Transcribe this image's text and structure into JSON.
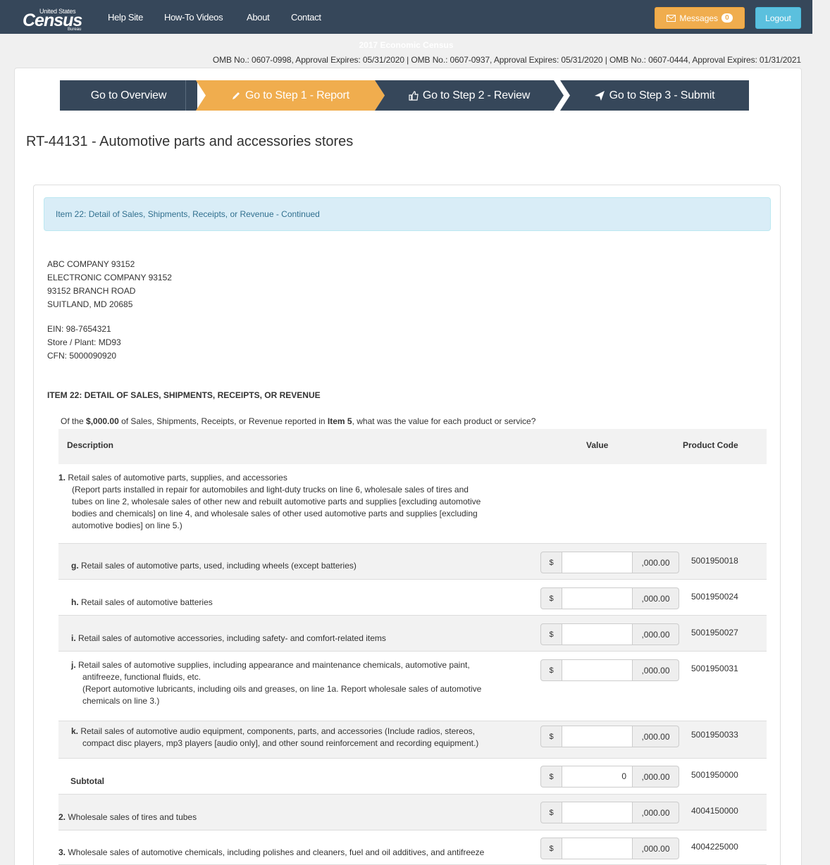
{
  "nav": {
    "logo_top": "United States",
    "logo_main": "Census",
    "logo_bottom": "Bureau",
    "links": [
      "Help Site",
      "How-To Videos",
      "About",
      "Contact"
    ],
    "messages_label": "Messages",
    "messages_count": "0",
    "logout_label": "Logout"
  },
  "header": {
    "title": "2017 Economic Census",
    "omb": "OMB No.: 0607-0998, Approval Expires: 05/31/2020  |  OMB No.: 0607-0937, Approval Expires: 05/31/2020  |  OMB No.: 0607-0444, Approval Expires: 01/31/2021"
  },
  "steps": [
    "Go to Overview",
    "Go to Step 1 - Report",
    "Go to Step 2 - Review",
    "Go to Step 3 - Submit"
  ],
  "page_title": "RT-44131 - Automotive parts and accessories stores",
  "alert": "Item 22: Detail of Sales, Shipments, Receipts, or Revenue - Continued",
  "company": {
    "lines": [
      "ABC COMPANY 93152",
      "ELECTRONIC COMPANY 93152",
      "93152 BRANCH ROAD",
      "SUITLAND, MD 20685"
    ],
    "ein": "EIN: 98-7654321",
    "store": "Store / Plant: MD93",
    "cfn": "CFN: 5000090920"
  },
  "item": {
    "heading": "ITEM 22: DETAIL OF SALES, SHIPMENTS, RECEIPTS, OR REVENUE",
    "q_pre": "Of the ",
    "q_amount": "$,000.00",
    "q_mid": " of Sales, Shipments, Receipts, or Revenue reported in ",
    "q_item": "Item 5",
    "q_post": ", what was the value for each product or service?"
  },
  "table": {
    "col_description": "Description",
    "col_value": "Value",
    "col_code": "Product Code",
    "currency": "$",
    "suffix": ",000.00"
  },
  "line1": {
    "num": "1.",
    "title": "Retail sales of automotive parts, supplies, and accessories",
    "note": [
      "(Report parts installed in repair for automobiles and light-duty trucks on line 6, wholesale sales of tires and",
      "tubes on line 2, wholesale sales of other new and rebuilt automotive parts and supplies [excluding automotive",
      "bodies and chemicals] on line 4, and wholesale sales of other used automotive parts and supplies [excluding",
      "automotive bodies] on line 5.)"
    ]
  },
  "rows": [
    {
      "letter": "g.",
      "text": [
        "Retail sales of automotive parts, used, including wheels (except batteries)"
      ],
      "value": "",
      "code": "5001950018"
    },
    {
      "letter": "h.",
      "text": [
        "Retail sales of automotive batteries"
      ],
      "value": "",
      "code": "5001950024"
    },
    {
      "letter": "i.",
      "text": [
        "Retail sales of automotive accessories, including safety- and comfort-related items"
      ],
      "value": "",
      "code": "5001950027"
    },
    {
      "letter": "j.",
      "text": [
        "Retail sales of automotive supplies, including appearance and maintenance chemicals, automotive paint,",
        "antifreeze, functional fluids, etc.",
        "(Report automotive lubricants, including oils and greases, on line 1a. Report wholesale sales of automotive",
        "chemicals on line 3.)"
      ],
      "value": "",
      "code": "5001950031"
    },
    {
      "letter": "k.",
      "text": [
        "Retail sales of automotive audio equipment, components, parts, and accessories (Include radios, stereos,",
        "compact disc players, mp3 players [audio only], and other sound reinforcement and recording equipment.)"
      ],
      "value": "",
      "code": "5001950033"
    },
    {
      "letter": "",
      "text": [
        "Subtotal"
      ],
      "value": "0",
      "code": "5001950000"
    },
    {
      "letter": "2.",
      "text": [
        "Wholesale sales of tires and tubes"
      ],
      "value": "",
      "code": "4004150000"
    },
    {
      "letter": "3.",
      "text": [
        "Wholesale sales of automotive chemicals, including polishes and cleaners, fuel and oil additives, and antifreeze"
      ],
      "value": "",
      "code": "4004225000"
    }
  ],
  "colors": {
    "nav": "#36475a",
    "active_step": "#f0ad4e",
    "step": "#36475a",
    "alert_bg": "#d9edf7"
  }
}
